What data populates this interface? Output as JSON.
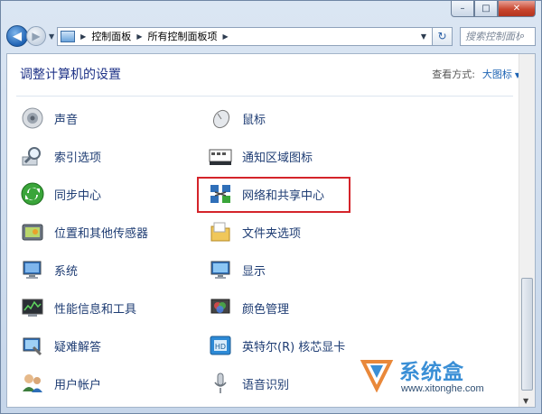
{
  "window": {
    "caption_buttons": {
      "minimize": "–",
      "maximize": "□",
      "close": "✕"
    }
  },
  "nav": {
    "back": "◀",
    "forward": "▶",
    "breadcrumbs": [
      "控制面板",
      "所有控制面板项"
    ],
    "refresh": "↻",
    "search_placeholder": "搜索控制面板"
  },
  "content": {
    "heading": "调整计算机的设置",
    "view_by_label": "查看方式:",
    "view_by_value": "大图标",
    "items_left": [
      {
        "label": "声音",
        "icon": "speaker-icon"
      },
      {
        "label": "索引选项",
        "icon": "indexing-magnifier-icon"
      },
      {
        "label": "同步中心",
        "icon": "sync-icon"
      },
      {
        "label": "位置和其他传感器",
        "icon": "location-sensor-icon"
      },
      {
        "label": "系统",
        "icon": "computer-system-icon"
      },
      {
        "label": "性能信息和工具",
        "icon": "performance-icon"
      },
      {
        "label": "疑难解答",
        "icon": "troubleshooting-icon"
      },
      {
        "label": "用户帐户",
        "icon": "user-accounts-icon"
      }
    ],
    "items_right": [
      {
        "label": "鼠标",
        "icon": "mouse-icon"
      },
      {
        "label": "通知区域图标",
        "icon": "notification-area-icon"
      },
      {
        "label": "网络和共享中心",
        "icon": "network-icon"
      },
      {
        "label": "文件夹选项",
        "icon": "folder-options-icon"
      },
      {
        "label": "显示",
        "icon": "display-icon"
      },
      {
        "label": "颜色管理",
        "icon": "color-management-icon"
      },
      {
        "label": "英特尔(R) 核芯显卡",
        "icon": "intel-graphics-icon"
      },
      {
        "label": "语音识别",
        "icon": "microphone-icon"
      }
    ],
    "highlighted_item": "网络和共享中心",
    "highlight_color": "#d4242a"
  },
  "watermark": {
    "brand": "系统盒",
    "url": "www.xitonghe.com"
  }
}
